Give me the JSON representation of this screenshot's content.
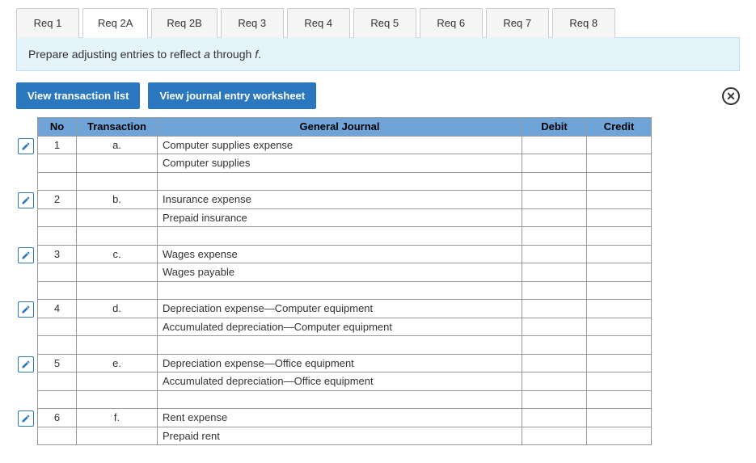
{
  "tabs": [
    {
      "label": "Req 1",
      "active": false
    },
    {
      "label": "Req 2A",
      "active": true
    },
    {
      "label": "Req 2B",
      "active": false
    },
    {
      "label": "Req 3",
      "active": false
    },
    {
      "label": "Req 4",
      "active": false
    },
    {
      "label": "Req 5",
      "active": false
    },
    {
      "label": "Req 6",
      "active": false
    },
    {
      "label": "Req 7",
      "active": false
    },
    {
      "label": "Req 8",
      "active": false
    }
  ],
  "instruction": {
    "prefix": "Prepare adjusting entries to reflect ",
    "em_a": "a",
    "through": " through ",
    "em_f": "f",
    "suffix": "."
  },
  "buttons": {
    "view_transaction_list": "View transaction list",
    "view_journal_worksheet": "View journal entry worksheet"
  },
  "headers": {
    "no": "No",
    "transaction": "Transaction",
    "general_journal": "General Journal",
    "debit": "Debit",
    "credit": "Credit"
  },
  "rows": [
    {
      "edit": true,
      "no": "1",
      "tx": "a.",
      "gj": "Computer supplies expense",
      "debit": "",
      "credit": ""
    },
    {
      "edit": false,
      "no": "",
      "tx": "",
      "gj": "Computer supplies",
      "debit": "",
      "credit": ""
    },
    {
      "edit": false,
      "no": "",
      "tx": "",
      "gj": "",
      "debit": "",
      "credit": ""
    },
    {
      "edit": true,
      "no": "2",
      "tx": "b.",
      "gj": "Insurance expense",
      "debit": "",
      "credit": ""
    },
    {
      "edit": false,
      "no": "",
      "tx": "",
      "gj": "Prepaid insurance",
      "debit": "",
      "credit": ""
    },
    {
      "edit": false,
      "no": "",
      "tx": "",
      "gj": "",
      "debit": "",
      "credit": ""
    },
    {
      "edit": true,
      "no": "3",
      "tx": "c.",
      "gj": "Wages expense",
      "debit": "",
      "credit": ""
    },
    {
      "edit": false,
      "no": "",
      "tx": "",
      "gj": "Wages payable",
      "debit": "",
      "credit": ""
    },
    {
      "edit": false,
      "no": "",
      "tx": "",
      "gj": "",
      "debit": "",
      "credit": ""
    },
    {
      "edit": true,
      "no": "4",
      "tx": "d.",
      "gj": "Depreciation expense—Computer equipment",
      "debit": "",
      "credit": ""
    },
    {
      "edit": false,
      "no": "",
      "tx": "",
      "gj": "Accumulated depreciation—Computer equipment",
      "debit": "",
      "credit": ""
    },
    {
      "edit": false,
      "no": "",
      "tx": "",
      "gj": "",
      "debit": "",
      "credit": ""
    },
    {
      "edit": true,
      "no": "5",
      "tx": "e.",
      "gj": "Depreciation expense—Office equipment",
      "debit": "",
      "credit": ""
    },
    {
      "edit": false,
      "no": "",
      "tx": "",
      "gj": "Accumulated depreciation—Office equipment",
      "debit": "",
      "credit": ""
    },
    {
      "edit": false,
      "no": "",
      "tx": "",
      "gj": "",
      "debit": "",
      "credit": ""
    },
    {
      "edit": true,
      "no": "6",
      "tx": "f.",
      "gj": "Rent expense",
      "debit": "",
      "credit": ""
    },
    {
      "edit": false,
      "no": "",
      "tx": "",
      "gj": "Prepaid rent",
      "debit": "",
      "credit": ""
    }
  ]
}
